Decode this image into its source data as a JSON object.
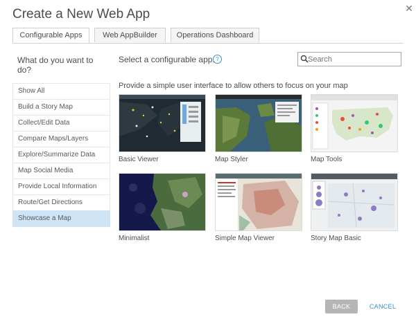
{
  "dialog": {
    "title": "Create a New Web App",
    "close_glyph": "✕"
  },
  "tabs": [
    {
      "label": "Configurable Apps",
      "active": true
    },
    {
      "label": "Web AppBuilder",
      "active": false
    },
    {
      "label": "Operations Dashboard",
      "active": false
    }
  ],
  "sidebar": {
    "question": "What do you want to do?",
    "items": [
      {
        "label": "Show All"
      },
      {
        "label": "Build a Story Map"
      },
      {
        "label": "Collect/Edit Data"
      },
      {
        "label": "Compare Maps/Layers"
      },
      {
        "label": "Explore/Summarize Data"
      },
      {
        "label": "Map Social Media"
      },
      {
        "label": "Provide Local Information"
      },
      {
        "label": "Route/Get Directions"
      },
      {
        "label": "Showcase a Map",
        "selected": true
      }
    ]
  },
  "main": {
    "select_label": "Select a configurable app.",
    "help_glyph": "?",
    "search": {
      "placeholder": "Search",
      "value": ""
    },
    "subtitle": "Provide a simple user interface to allow others to focus on your map",
    "apps": [
      {
        "label": "Basic Viewer"
      },
      {
        "label": "Map Styler"
      },
      {
        "label": "Map Tools"
      },
      {
        "label": "Minimalist"
      },
      {
        "label": "Simple Map Viewer"
      },
      {
        "label": "Story Map Basic"
      }
    ]
  },
  "footer": {
    "back_label": "BACK",
    "cancel_label": "CANCEL"
  },
  "colors": {
    "accent": "#3b8fcf",
    "selected_bg": "#cfe5f5",
    "back_button": "#b5b5b5"
  }
}
